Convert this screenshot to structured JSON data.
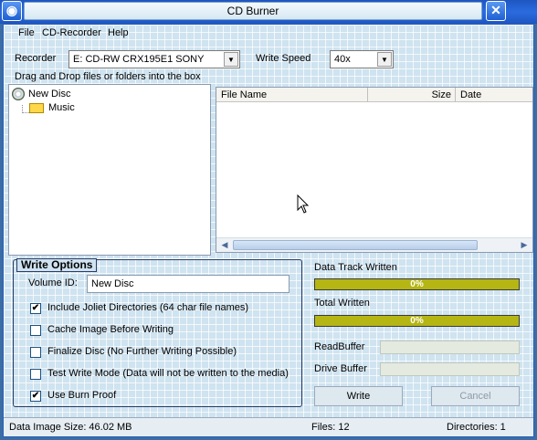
{
  "window": {
    "title": "CD Burner"
  },
  "menu": {
    "file": "File",
    "recorder": "CD-Recorder",
    "help": "Help"
  },
  "recorder": {
    "label": "Recorder",
    "value": "E: CD-RW  CRX195E1  SONY"
  },
  "write_speed": {
    "label": "Write Speed",
    "value": "40x"
  },
  "hint": "Drag and Drop files or folders into the box",
  "tree": {
    "root_label": "New Disc",
    "child_label": "Music"
  },
  "file_list": {
    "columns": [
      "File Name",
      "Size",
      "Date"
    ],
    "rows": []
  },
  "write_options": {
    "title": "Write Options",
    "volume_id_label": "Volume ID:",
    "volume_id_value": "New Disc",
    "options": [
      {
        "label": "Include Joliet Directories (64 char file names)",
        "checked": true
      },
      {
        "label": "Cache Image Before Writing",
        "checked": false
      },
      {
        "label": "Finalize Disc (No Further Writing Possible)",
        "checked": false
      },
      {
        "label": "Test Write Mode (Data will not be written to the media)",
        "checked": false
      },
      {
        "label": "Use Burn Proof",
        "checked": true
      }
    ]
  },
  "progress": {
    "data_track_label": "Data Track Written",
    "data_track_value": "0%",
    "data_track_fraction": 0,
    "total_label": "Total Written",
    "total_value": "0%",
    "total_fraction": 0
  },
  "buffers": {
    "read_label": "ReadBuffer",
    "drive_label": "Drive Buffer"
  },
  "buttons": {
    "write": "Write",
    "cancel": "Cancel"
  },
  "status": {
    "image_size": "Data Image Size: 46.02 MB",
    "files": "Files: 12",
    "directories": "Directories: 1"
  },
  "colors": {
    "titlebar": "#1e56c0",
    "progress_fill": "#b5b514",
    "grid_bg": "#cfe3f0"
  }
}
